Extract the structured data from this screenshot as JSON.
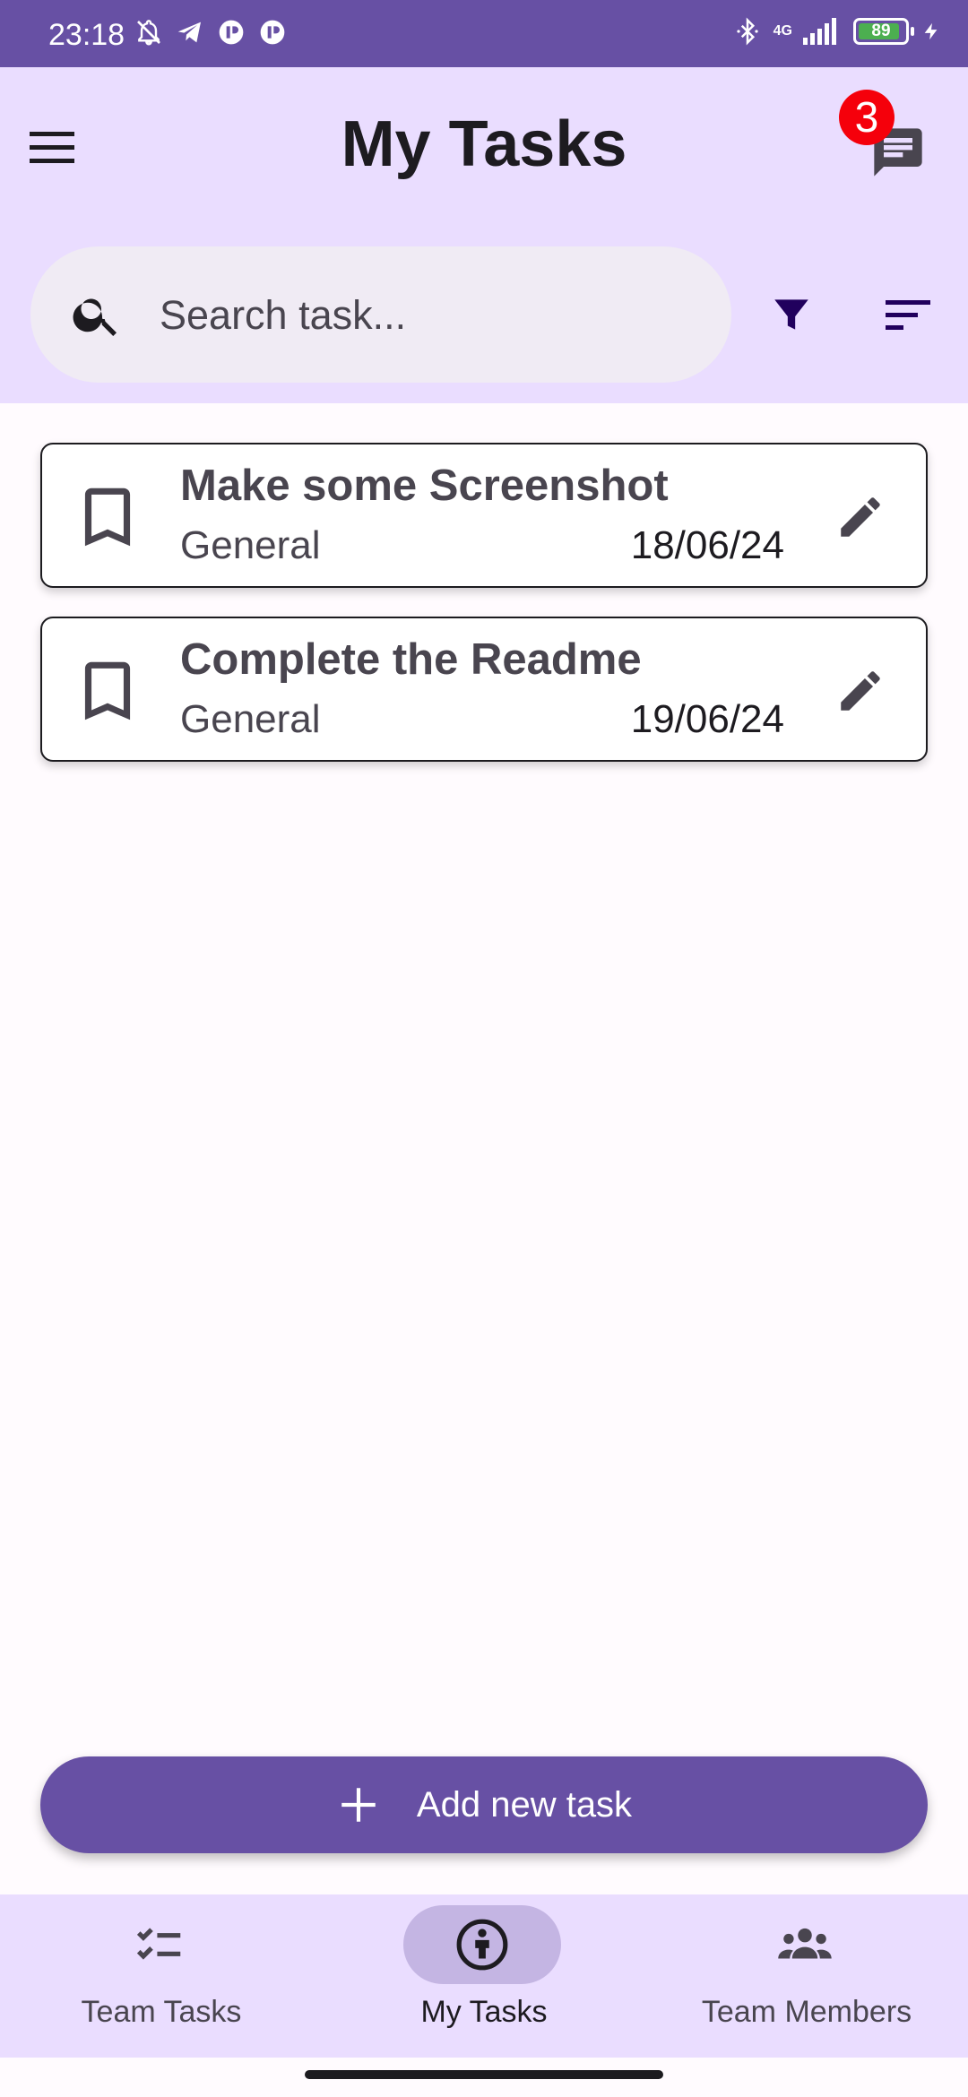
{
  "status_bar": {
    "time": "23:18",
    "network": "4G",
    "battery": "89",
    "battery_fraction": 0.89
  },
  "header": {
    "title": "My Tasks",
    "message_badge": "3",
    "menu_icon": "hamburger-menu-icon",
    "messages_icon": "chat-icon"
  },
  "search": {
    "placeholder": "Search task...",
    "value": ""
  },
  "tasks": [
    {
      "title": "Make some Screenshot",
      "category": "General",
      "date": "18/06/24"
    },
    {
      "title": "Complete the Readme",
      "category": "General",
      "date": "19/06/24"
    }
  ],
  "add_button": {
    "label": "Add new task"
  },
  "bottom_nav": {
    "items": [
      {
        "label": "Team Tasks",
        "icon": "checklist-icon",
        "active": false
      },
      {
        "label": "My Tasks",
        "icon": "person-info-icon",
        "active": true
      },
      {
        "label": "Team Members",
        "icon": "group-icon",
        "active": false
      }
    ]
  },
  "colors": {
    "primary": "#6750a4",
    "app_bar": "#eaddff",
    "badge": "#f5000b",
    "active_pill": "#c4b5e3",
    "filter_icon": "#21005d"
  }
}
